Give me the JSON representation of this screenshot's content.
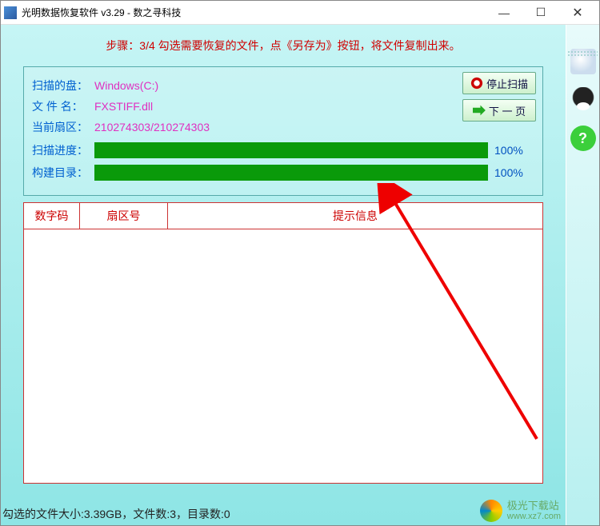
{
  "title": "光明数据恢复软件 v3.29 - 数之寻科技",
  "step_banner": "步骤：3/4 勾选需要恢复的文件，点《另存为》按钮，将文件复制出来。",
  "info": {
    "disk_label": "扫描的盘：",
    "disk_value": "Windows(C:)",
    "filename_label": "文 件 名：",
    "filename_value": "FXSTIFF.dll",
    "sector_label": "当前扇区：",
    "sector_value": "210274303/210274303"
  },
  "progress": {
    "scan_label": "扫描进度：",
    "scan_pct": "100%",
    "build_label": "构建目录：",
    "build_pct": "100%"
  },
  "buttons": {
    "stop_scan": "停止扫描",
    "next_page": "下 一 页"
  },
  "table": {
    "col1": "数字码",
    "col2": "扇区号",
    "col3": "提示信息"
  },
  "status": "勾选的文件大小:3.39GB，文件数:3，目录数:0",
  "watermark": {
    "name": "极光下载站",
    "url": "www.xz7.com"
  },
  "help_glyph": "?"
}
